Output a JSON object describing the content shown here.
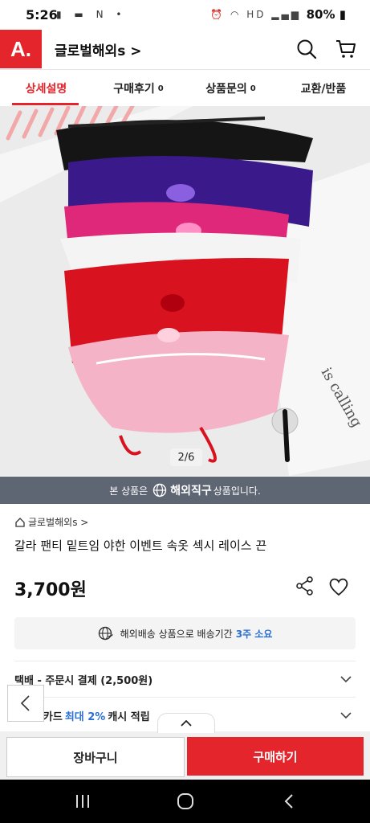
{
  "status": {
    "time": "5:26",
    "left_icons": "▮ ▬ N •",
    "right_icons": "⏰ ◠ HD ▂▄▆",
    "battery": "80%"
  },
  "header": {
    "logo": "A.",
    "store_title": "글로벌해외s >"
  },
  "tabs": [
    {
      "label": "상세설명",
      "count": ""
    },
    {
      "label": "구매후기",
      "count": "0"
    },
    {
      "label": "상품문의",
      "count": "0"
    },
    {
      "label": "교환/반품",
      "count": ""
    }
  ],
  "image": {
    "pager": "2/6"
  },
  "banner": {
    "prefix": "본 상품은",
    "highlight": "해외직구",
    "suffix": "상품입니다."
  },
  "product": {
    "breadcrumb": "글로벌해외s >",
    "name": "갈라 팬티 밑트임 야한 이벤트 속옷 섹시 레이스 끈",
    "price": "3,700원"
  },
  "shipping_notice": {
    "text": "해외배송 상품으로 배송기간",
    "highlight": "3주 소요"
  },
  "rows": [
    {
      "text": "택배 - 주문시 결제 (2,500원)"
    },
    {
      "pre": "스마일카드",
      "highlight": "최대 2%",
      "post": "캐시 적립"
    }
  ],
  "buttons": {
    "cart": "장바구니",
    "buy": "구매하기"
  },
  "colors": {
    "brand": "#e5252c",
    "banner": "#5e6573",
    "accent_blue": "#2a6fd6"
  }
}
